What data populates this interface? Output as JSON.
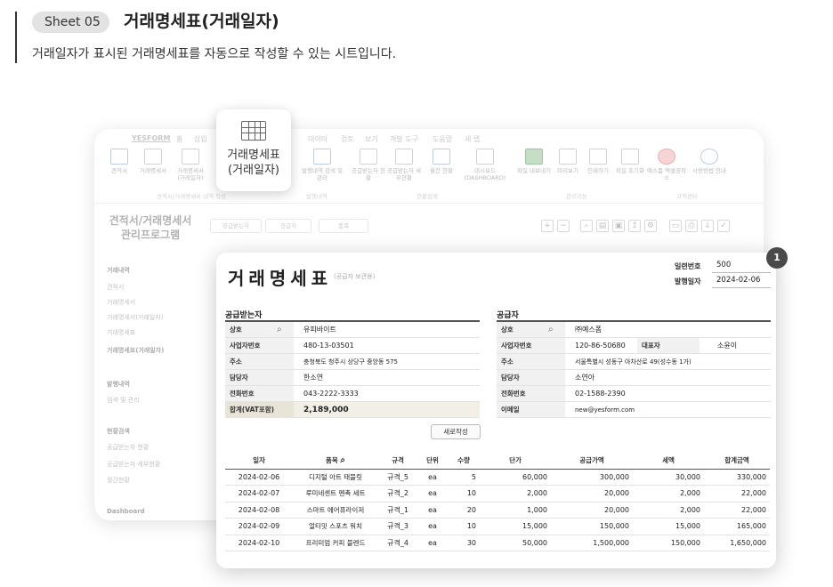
{
  "header": {
    "sheet_tag": "Sheet 05",
    "title": "거래명세표(거래일자)",
    "description": "거래일자가 표시된 거래명세표를 자동으로 작성할 수 있는 시트입니다."
  },
  "tooltip": {
    "line1": "거래명세표",
    "line2": "(거래일자)"
  },
  "background_app": {
    "menu": [
      "YESFORM",
      "홈",
      "삽입",
      "데이터",
      "검토",
      "보기",
      "개발 도구",
      "도움말",
      "새 탭"
    ],
    "ribbon": [
      "견적서",
      "거래명세서",
      "거래명세서 (거래일자)",
      "발행내역 검색 및 관리",
      "공급받는자 현황",
      "공급받는자 세부현황",
      "월간 현황",
      "대시보드 (DASHBOARD)",
      "파일 내보내기",
      "미리보기",
      "인쇄하기",
      "파일 초기화",
      "예스폼 엑셀공작소",
      "사용방법 안내"
    ],
    "groups": [
      "견적서/거래명세서 내역 작성",
      "발행내역",
      "현황검색",
      "관리기능",
      "고객센터"
    ],
    "title_line1": "견적서/거래명세서",
    "title_line2": "관리프로그램",
    "buttons": [
      "공급받는자",
      "공급자",
      "품목"
    ],
    "sidebar": {
      "section1": "거래내역",
      "items1": [
        "견적서",
        "거래명세서",
        "거래명세서(거래일자)",
        "거래명세표",
        "거래명세표(거래일자)"
      ],
      "section2": "발행내역",
      "items2": [
        "검색 및 관리"
      ],
      "section3": "현황검색",
      "items3": [
        "공급받는자 현황",
        "공급받는자 세부현황",
        "월간현황"
      ],
      "footer": "Dashboard"
    }
  },
  "invoice": {
    "title": "거래명세표",
    "subtitle": "(공급자 보관용)",
    "badge": "1",
    "serial_label": "일련번호",
    "serial_value": "500",
    "date_label": "발행일자",
    "date_value": "2024-02-06",
    "buyer": {
      "section": "공급받는자",
      "rows": [
        {
          "label": "상호",
          "value": "유피바이트"
        },
        {
          "label": "사업자번호",
          "value": "480-13-03501"
        },
        {
          "label": "주소",
          "value": "충청북도 청주시 상당구 중앙동 575"
        },
        {
          "label": "담당자",
          "value": "한소연"
        },
        {
          "label": "전화번호",
          "value": "043-2222-3333"
        }
      ],
      "total_label": "합계(VAT포함)",
      "total_value": "2,189,000"
    },
    "supplier": {
      "section": "공급자",
      "rows": [
        {
          "label": "상호",
          "value": "㈜예스폼"
        },
        {
          "label": "사업자번호",
          "value": "120-86-50680"
        },
        {
          "label": "주소",
          "value": "서울특별시 성동구 아차산로 49(성수동 1가)"
        },
        {
          "label": "담당자",
          "value": "소연아"
        },
        {
          "label": "전화번호",
          "value": "02-1588-2390"
        },
        {
          "label": "이메일",
          "value": "new@yesform.com"
        }
      ],
      "rep_label": "대표자",
      "rep_value": "소윤이"
    },
    "new_button": "새로작성",
    "columns": [
      "일자",
      "품목",
      "규격",
      "단위",
      "수량",
      "단가",
      "공급가액",
      "세액",
      "합계금액"
    ],
    "items": [
      [
        "2024-02-06",
        "디지털 아트 태블릿",
        "규격_5",
        "ea",
        "5",
        "60,000",
        "300,000",
        "30,000",
        "330,000"
      ],
      [
        "2024-02-07",
        "루미네센트 펜촉 세트",
        "규격_2",
        "ea",
        "10",
        "2,000",
        "20,000",
        "2,000",
        "22,000"
      ],
      [
        "2024-02-08",
        "스마트 에어퓨라이저",
        "규격_1",
        "ea",
        "20",
        "1,000",
        "20,000",
        "2,000",
        "22,000"
      ],
      [
        "2024-02-09",
        "얼티밋 스포츠 워치",
        "규격_3",
        "ea",
        "10",
        "15,000",
        "150,000",
        "15,000",
        "165,000"
      ],
      [
        "2024-02-10",
        "프리미엄 커피 블렌드",
        "규격_4",
        "ea",
        "30",
        "50,000",
        "1,500,000",
        "150,000",
        "1,650,000"
      ]
    ]
  }
}
